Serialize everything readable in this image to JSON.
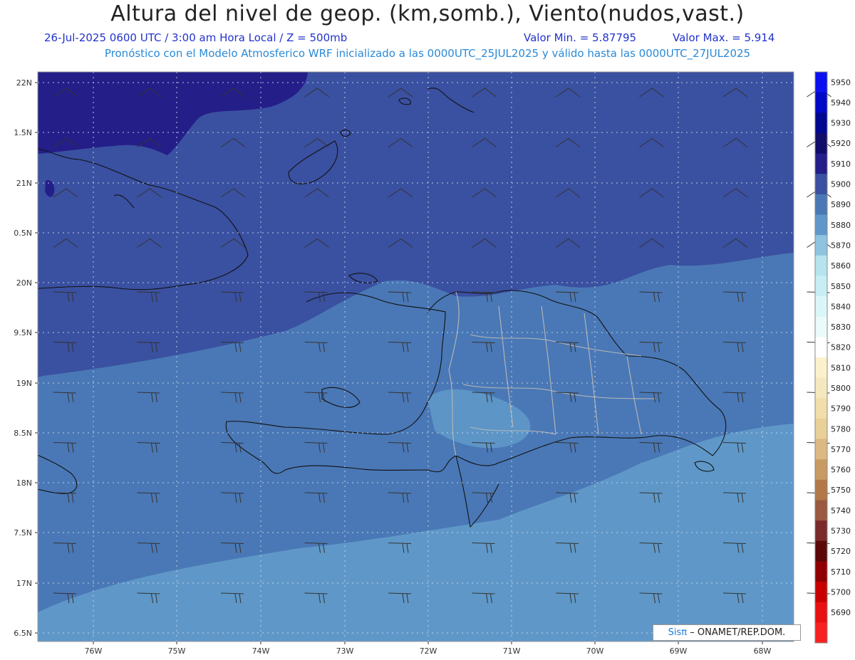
{
  "header": {
    "title": "Altura del nivel de geop. (km,somb.), Viento(nudos,vast.)",
    "datetime": "26-Jul-2025   0600 UTC / 3:00 am Hora Local / Z = 500mb",
    "valmin": "Valor Min. = 5.87795",
    "valmax": "Valor Max. = 5.914",
    "model_line": "Pronóstico con el Modelo Atmosferico WRF inicializado a las 0000UTC_25JUL2025 y válido hasta las  0000UTC_27JUL2025"
  },
  "map": {
    "lat_labels": [
      "22N",
      "1.5N",
      "21N",
      "0.5N",
      "20N",
      "9.5N",
      "19N",
      "8.5N",
      "18N",
      "7.5N",
      "17N",
      "6.5N"
    ],
    "lon_labels": [
      "76W",
      "75W",
      "74W",
      "73W",
      "72W",
      "71W",
      "70W",
      "69W",
      "68W"
    ]
  },
  "colorbar": {
    "labels": [
      "5950",
      "5940",
      "5930",
      "5920",
      "5910",
      "5900",
      "5890",
      "5880",
      "5870",
      "5860",
      "5850",
      "5840",
      "5830",
      "5820",
      "5810",
      "5800",
      "5790",
      "5780",
      "5770",
      "5760",
      "5750",
      "5740",
      "5730",
      "5720",
      "5710",
      "5700",
      "5690"
    ],
    "colors": [
      "#0a10f0",
      "#0008c8",
      "#000890",
      "#120c6a",
      "#241e88",
      "#3a50a0",
      "#4a78b6",
      "#5f98c8",
      "#8ec4e0",
      "#b6e4ee",
      "#c8eef4",
      "#daf6f8",
      "#ebfafa",
      "#ffffff",
      "#fbf2cc",
      "#f6e8be",
      "#f1deaa",
      "#e8d098",
      "#dcb882",
      "#c89a64",
      "#b27848",
      "#9a5a40",
      "#7a2a2a",
      "#5a0808",
      "#900000",
      "#c80000",
      "#e81010",
      "#f82020"
    ]
  },
  "credit": {
    "sis": "Sisπ",
    "org": "– ONAMET/REP.DOM."
  }
}
